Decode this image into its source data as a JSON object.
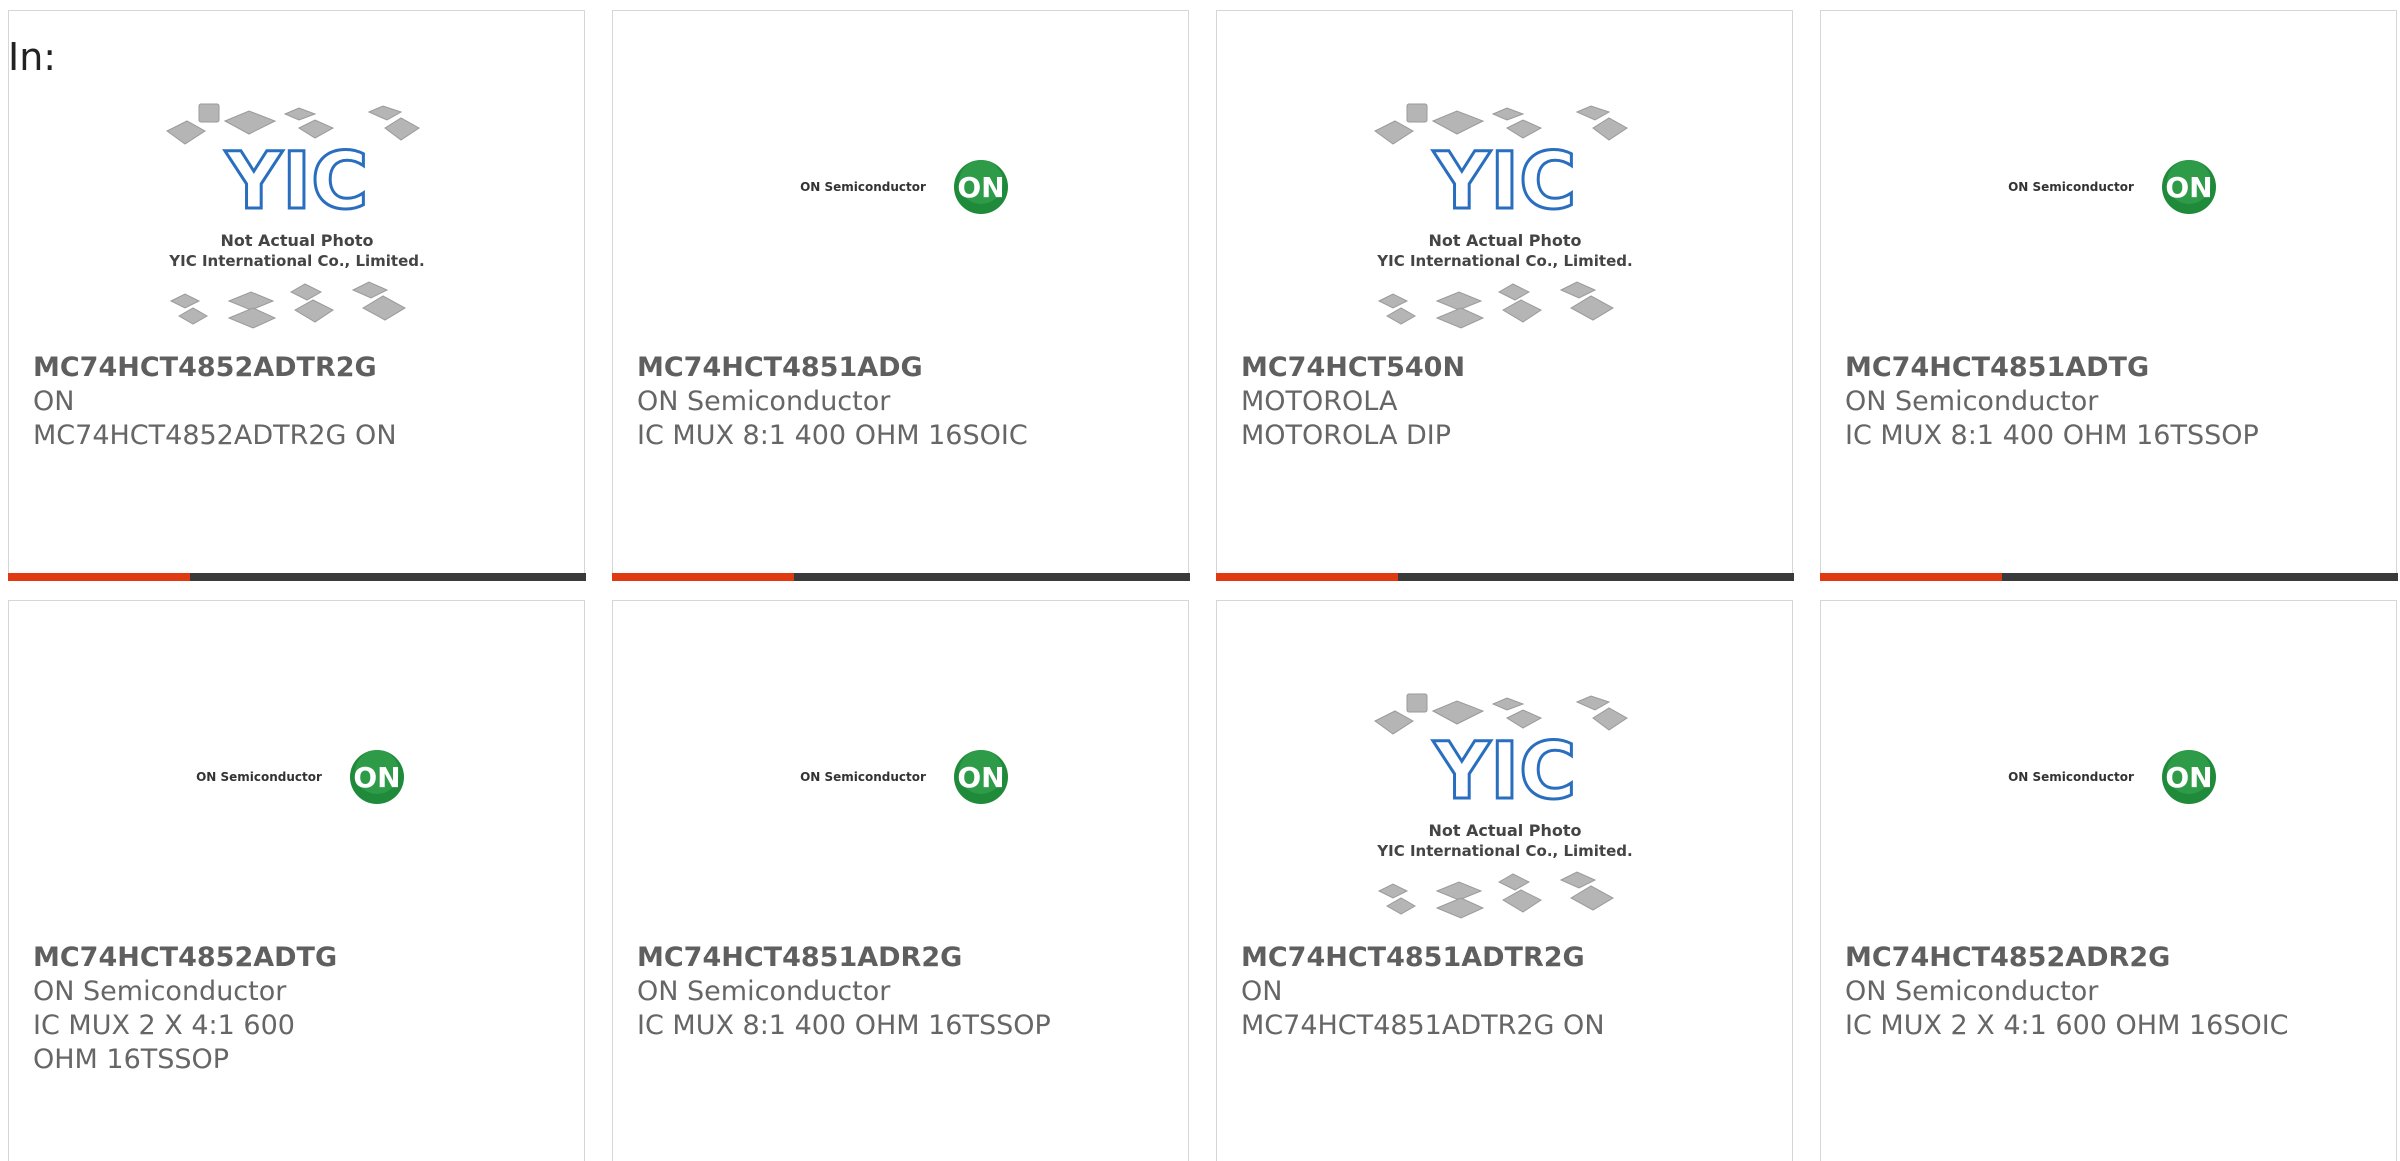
{
  "header": {
    "in_label": "In:"
  },
  "placeholder": {
    "line1": "Not Actual Photo",
    "line2": "YIC International Co., Limited.",
    "logo_text": "YIC"
  },
  "brand": {
    "on_text": "ON Semiconductor",
    "on_badge": "ON"
  },
  "colors": {
    "accent_red": "#e03a13",
    "bar_dark": "#3a3a3a",
    "on_green": "#1f8a3a",
    "yic_blue": "#2a6fbf"
  },
  "products": [
    {
      "part": "MC74HCT4852ADTR2G",
      "maker": "ON",
      "desc": "MC74HCT4852ADTR2G ON",
      "image": "yic-placeholder"
    },
    {
      "part": "MC74HCT4851ADG",
      "maker": "ON Semiconductor",
      "desc": "IC MUX 8:1 400 OHM 16SOIC",
      "image": "on-semi-logo"
    },
    {
      "part": "MC74HCT540N",
      "maker": "MOTOROLA",
      "desc": "MOTOROLA DIP",
      "image": "yic-placeholder"
    },
    {
      "part": "MC74HCT4851ADTG",
      "maker": "ON Semiconductor",
      "desc": "IC MUX 8:1 400 OHM 16TSSOP",
      "image": "on-semi-logo"
    },
    {
      "part": "MC74HCT4852ADTG",
      "maker": "ON Semiconductor",
      "desc": "IC MUX 2 X 4:1 600 OHM 16TSSOP",
      "image": "on-semi-logo"
    },
    {
      "part": "MC74HCT4851ADR2G",
      "maker": "ON Semiconductor",
      "desc": "IC MUX 8:1 400 OHM 16TSSOP",
      "image": "on-semi-logo"
    },
    {
      "part": "MC74HCT4851ADTR2G",
      "maker": "ON",
      "desc": "MC74HCT4851ADTR2G ON",
      "image": "yic-placeholder"
    },
    {
      "part": "MC74HCT4852ADR2G",
      "maker": "ON Semiconductor",
      "desc": "IC MUX 2 X 4:1 600 OHM 16SOIC",
      "image": "on-semi-logo"
    }
  ]
}
